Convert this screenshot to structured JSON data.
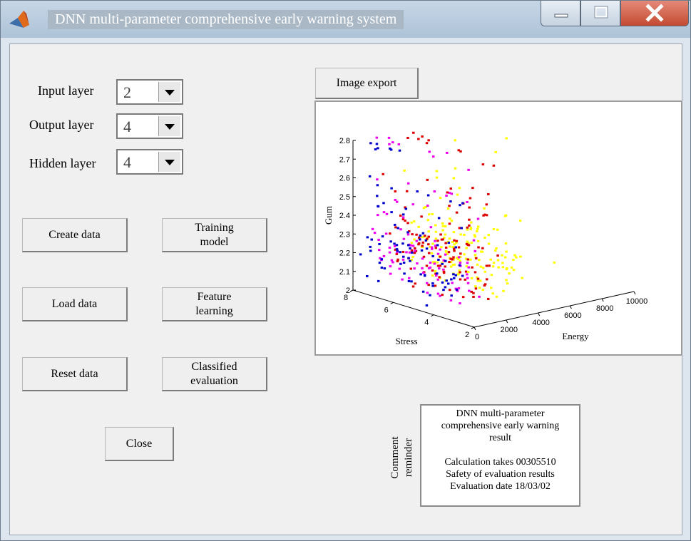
{
  "window": {
    "title": "DNN multi-parameter comprehensive early warning system",
    "controls": [
      "minimize",
      "maximize",
      "close"
    ]
  },
  "params": {
    "input_label": "Input layer",
    "input_value": "2",
    "output_label": "Output layer",
    "output_value": "4",
    "hidden_label": "Hidden layer",
    "hidden_value": "4"
  },
  "buttons": {
    "create": "Create data",
    "training": "Training\nmodel",
    "load": "Load data",
    "feature": "Feature\nlearning",
    "reset": "Reset data",
    "classified": "Classified\nevaluation",
    "close": "Close",
    "export": "Image export"
  },
  "comment": {
    "label": "Comment reminder",
    "lines": [
      "DNN multi-parameter",
      "comprehensive early warning",
      "result",
      "",
      "Calculation takes 00305510",
      "Safety of evaluation results",
      "Evaluation date 18/03/02"
    ]
  },
  "chart_data": {
    "type": "scatter",
    "dimension": "3d",
    "xlabel": "Energy",
    "ylabel": "Stress",
    "zlabel": "Gum",
    "x_ticks": [
      "0",
      "2000",
      "4000",
      "6000",
      "8000",
      "10000"
    ],
    "y_ticks": [
      "2",
      "4",
      "6",
      "8"
    ],
    "z_ticks": [
      "2",
      "2.1",
      "2.2",
      "2.3",
      "2.4",
      "2.5",
      "2.6",
      "2.7",
      "2.8"
    ],
    "xlim": [
      0,
      10000
    ],
    "ylim": [
      2,
      8
    ],
    "zlim": [
      2,
      2.8
    ],
    "grid": false,
    "series_colors": [
      "#0000cc",
      "#dd0000",
      "#ee00ee",
      "#ffff00"
    ]
  }
}
